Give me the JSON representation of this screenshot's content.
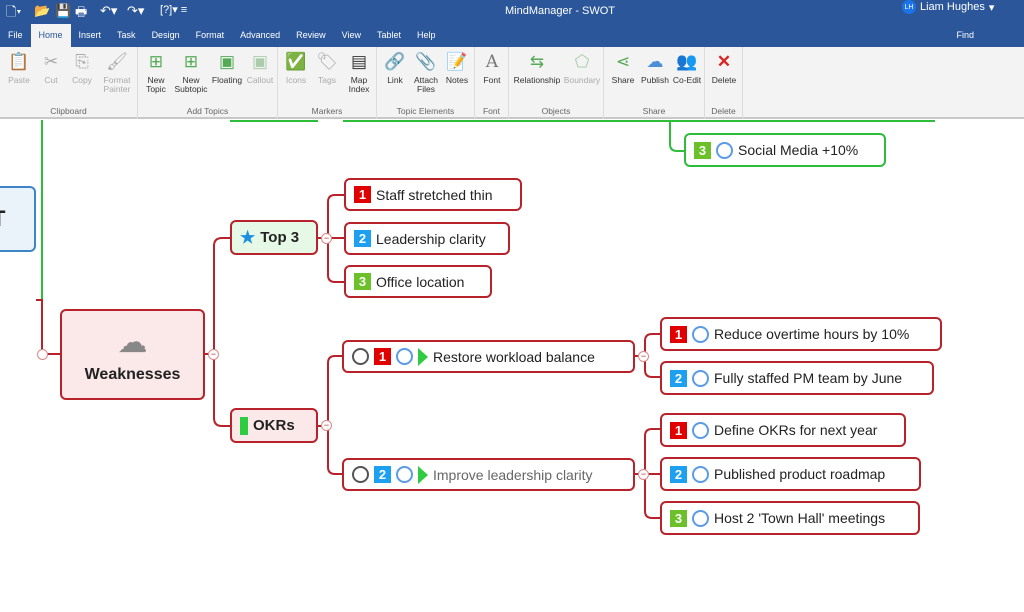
{
  "window": {
    "title": "MindManager - SWOT",
    "user_initials": "LH",
    "user_name": "Liam Hughes"
  },
  "tabs": [
    "File",
    "Home",
    "Insert",
    "Task",
    "Design",
    "Format",
    "Advanced",
    "Review",
    "View",
    "Tablet",
    "Help"
  ],
  "active_tab": "Home",
  "find_label": "Find",
  "ribbon": {
    "groups": [
      {
        "label": "Clipboard",
        "buttons": [
          "Paste",
          "Cut",
          "Copy",
          "Format Painter"
        ]
      },
      {
        "label": "Add Topics",
        "buttons": [
          "New Topic",
          "New Subtopic",
          "Floating",
          "Callout"
        ]
      },
      {
        "label": "Markers",
        "buttons": [
          "Icons",
          "Tags",
          "Map Index"
        ]
      },
      {
        "label": "Topic Elements",
        "buttons": [
          "Link",
          "Attach Files",
          "Notes"
        ]
      },
      {
        "label": "Font",
        "buttons": [
          "Font"
        ]
      },
      {
        "label": "Objects",
        "buttons": [
          "Relationship",
          "Boundary"
        ]
      },
      {
        "label": "Share",
        "buttons": [
          "Share",
          "Publish",
          "Co-Edit"
        ]
      },
      {
        "label": "Delete",
        "buttons": [
          "Delete"
        ]
      }
    ]
  },
  "map": {
    "central_partial": "T",
    "weaknesses": {
      "label": "Weaknesses",
      "icon": "storm-cloud-icon"
    },
    "top3": {
      "label": "Top 3",
      "icon": "star-icon",
      "children": [
        {
          "priority": "1",
          "label": "Staff stretched thin"
        },
        {
          "priority": "2",
          "label": "Leadership clarity"
        },
        {
          "priority": "3",
          "label": "Office location"
        }
      ]
    },
    "okrs": {
      "label": "OKRs",
      "icon": "green-flag-icon",
      "children": [
        {
          "priority": "1",
          "label": "Restore workload balance",
          "children": [
            {
              "priority": "1",
              "label": "Reduce overtime hours by 10%"
            },
            {
              "priority": "2",
              "label": "Fully staffed PM team by June"
            }
          ]
        },
        {
          "priority": "2",
          "label": "Improve leadership clarity",
          "children": [
            {
              "priority": "1",
              "label": "Define OKRs for next year"
            },
            {
              "priority": "2",
              "label": "Published product roadmap"
            },
            {
              "priority": "3",
              "label": "Host 2 'Town Hall' meetings"
            }
          ]
        }
      ]
    },
    "social": {
      "priority": "3",
      "label": "Social Media +10%"
    }
  },
  "colors": {
    "accent": "#2b579a",
    "weakness_border": "#b8222b",
    "strength_border": "#2ebd3a",
    "central_border": "#3d85c6"
  }
}
